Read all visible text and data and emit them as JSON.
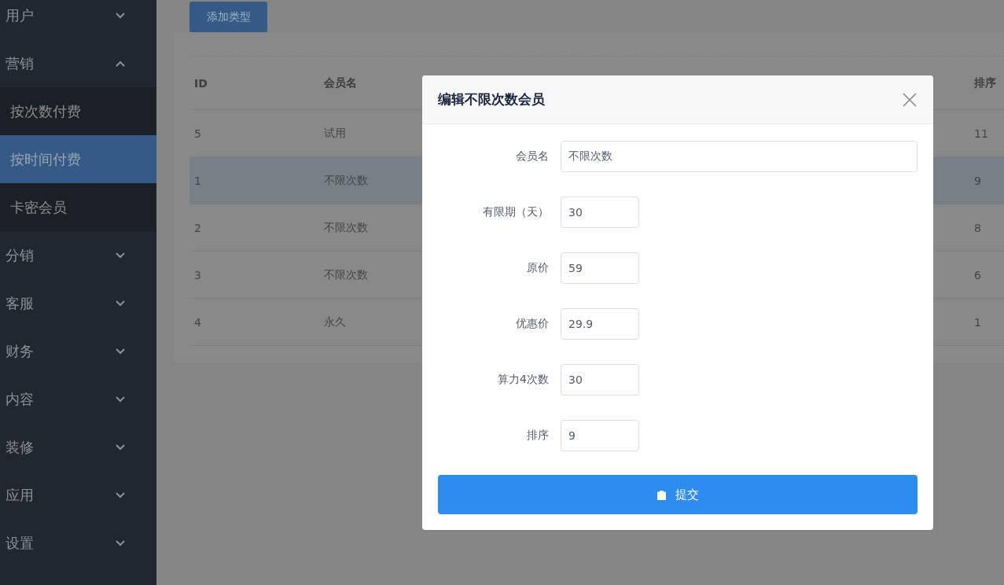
{
  "sidebar": {
    "items": [
      {
        "label": "用户",
        "expanded": false
      },
      {
        "label": "营销",
        "expanded": true,
        "children": [
          {
            "label": "按次数付费",
            "selected": false
          },
          {
            "label": "按时间付费",
            "selected": true
          },
          {
            "label": "卡密会员",
            "selected": false
          }
        ]
      },
      {
        "label": "分销",
        "expanded": false
      },
      {
        "label": "客服",
        "expanded": false
      },
      {
        "label": "财务",
        "expanded": false
      },
      {
        "label": "内容",
        "expanded": false
      },
      {
        "label": "装修",
        "expanded": false
      },
      {
        "label": "应用",
        "expanded": false
      },
      {
        "label": "设置",
        "expanded": false
      }
    ]
  },
  "toolbar": {
    "add_button": "添加类型"
  },
  "table": {
    "columns": [
      "ID",
      "会员名",
      "排序"
    ],
    "rows": [
      {
        "cells": [
          "5",
          "试用",
          "11"
        ],
        "selected": false
      },
      {
        "cells": [
          "1",
          "不限次数",
          "9"
        ],
        "selected": true
      },
      {
        "cells": [
          "2",
          "不限次数",
          "8"
        ],
        "selected": false
      },
      {
        "cells": [
          "3",
          "不限次数",
          "6"
        ],
        "selected": false
      },
      {
        "cells": [
          "4",
          "永久",
          "1"
        ],
        "selected": false
      }
    ]
  },
  "dialog": {
    "title": "编辑不限次数会员",
    "fields": [
      {
        "label": "会员名",
        "value": "不限次数",
        "kind": "wide"
      },
      {
        "label": "有限期（天）",
        "value": "30",
        "kind": "narrow"
      },
      {
        "label": "原价",
        "value": "59",
        "kind": "narrow"
      },
      {
        "label": "优惠价",
        "value": "29.9",
        "kind": "narrow"
      },
      {
        "label": "算力4次数",
        "value": "30",
        "kind": "narrow"
      },
      {
        "label": "排序",
        "value": "9",
        "kind": "narrow"
      }
    ],
    "submit": "提交"
  }
}
